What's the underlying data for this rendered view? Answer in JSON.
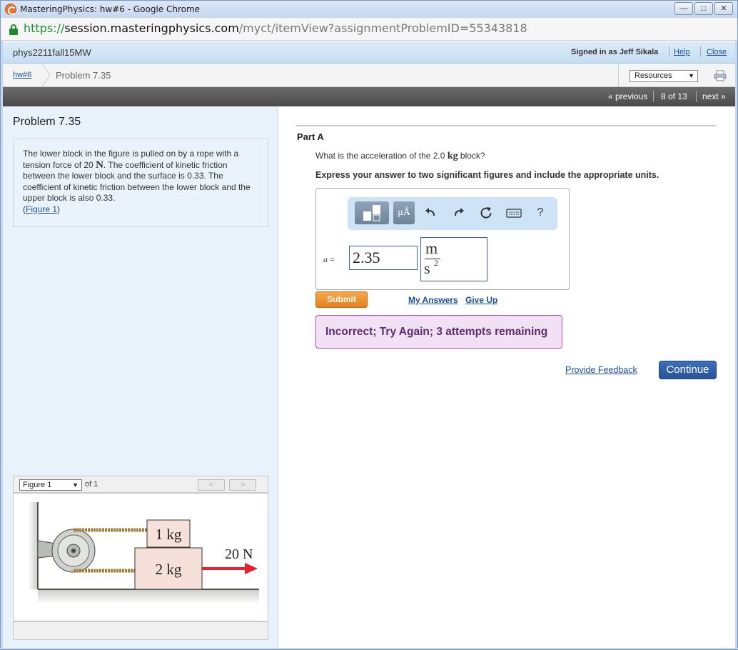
{
  "window": {
    "title": "MasteringPhysics: hw#6 - Google Chrome",
    "controls": [
      "minimize",
      "maximize",
      "close"
    ]
  },
  "address": {
    "scheme": "https://",
    "host": "session.masteringphysics.com",
    "path": "/myct/itemView?assignmentProblemID=55343818"
  },
  "header": {
    "course": "phys2211fall15MW",
    "signed_in": "Signed in as Jeff Sikala",
    "help": "Help",
    "close": "Close"
  },
  "breadcrumb": {
    "assignment": "hw#6",
    "current": "Problem 7.35",
    "resources": "Resources"
  },
  "nav": {
    "previous": "« previous",
    "position": "8 of 13",
    "next": "next »"
  },
  "problem": {
    "title": "Problem 7.35",
    "text_1": "The lower block in the figure is pulled on by a rope with a tension force of 20 ",
    "force_unit": "N",
    "text_2": ". The coefficient of kinetic friction between the lower block and the surface is 0.33. The coefficient of kinetic friction between the lower block and the upper block is also 0.33.",
    "figure_link_open": "(",
    "figure_link": "Figure 1",
    "figure_link_close": ")"
  },
  "figure": {
    "select_value": "Figure 1",
    "of_label": "of 1",
    "prev": "<",
    "next": ">",
    "upper_block": "1 kg",
    "lower_block": "2 kg",
    "force": "20 N"
  },
  "part": {
    "label": "Part A",
    "question_1": "What is the acceleration of the 2.0 ",
    "question_unit": "kg",
    "question_2": " block?",
    "instruction": "Express your answer to two significant figures and include the appropriate units."
  },
  "answer": {
    "variable": "a",
    "equals": " =",
    "value": "2.35",
    "unit_numerator": "m",
    "unit_denominator": "s",
    "unit_exponent": "2",
    "toolbar_units": "μÅ",
    "help": "?"
  },
  "actions": {
    "submit": "Submit",
    "my_answers": "My Answers",
    "give_up": "Give Up",
    "feedback": "Incorrect; Try Again; 3 attempts remaining",
    "provide_feedback": "Provide Feedback",
    "continue": "Continue"
  },
  "colors": {
    "submit": "#e5811f",
    "continue": "#27539a",
    "feedback_bg": "#f2e0f5",
    "feedback_border": "#a64eb5",
    "force_arrow": "#e8202e"
  }
}
